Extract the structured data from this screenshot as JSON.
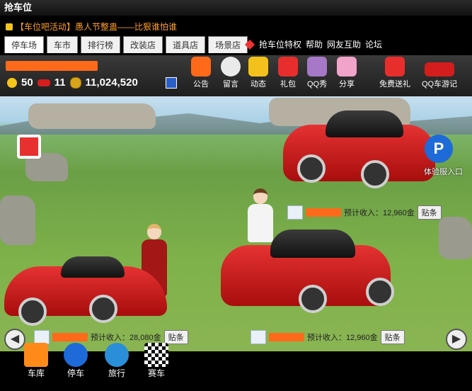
{
  "title": "抢车位",
  "notice": "【车位吧活动】愚人节整蛊——比狠谁怕谁",
  "tabs": [
    "停车场",
    "车市",
    "排行榜",
    "改装店",
    "道具店",
    "场景店"
  ],
  "links": [
    "抢车位特权",
    "帮助",
    "网友互助",
    "论坛"
  ],
  "stats": {
    "level": "50",
    "cars": "11",
    "money": "11,024,520"
  },
  "actions": [
    "公告",
    "留言",
    "动态",
    "礼包",
    "QQ秀",
    "分享",
    "免费送礼",
    "QQ车游记"
  ],
  "experience_entrance": "体验服入口",
  "spots": [
    {
      "income": "预计收入：12,960金",
      "button": "贴条"
    },
    {
      "income": "预计收入：28,080金",
      "button": "贴条"
    },
    {
      "income": "预计收入：12,960金",
      "button": "贴条"
    }
  ],
  "dock": [
    "车库",
    "停车",
    "旅行",
    "赛车"
  ],
  "colors": {
    "accent": "#ff9f2a",
    "car_red": "#d41d1d",
    "brand_blue": "#1d6ad8"
  }
}
